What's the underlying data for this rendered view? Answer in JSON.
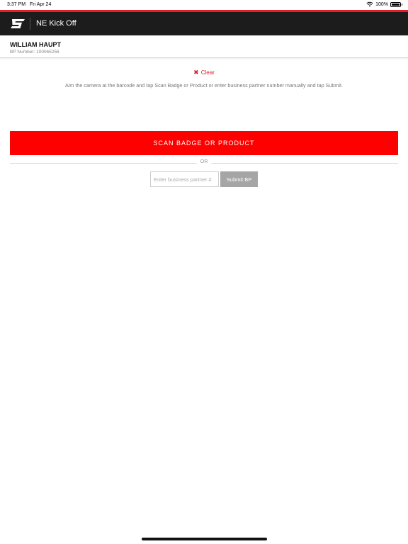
{
  "status_bar": {
    "time": "3:37 PM",
    "date": "Fri Apr 24",
    "battery": "100%",
    "wifi_icon": "wifi-icon",
    "battery_icon": "battery-icon"
  },
  "header": {
    "logo_icon": "snap-on-logo-icon",
    "title": "NE Kick Off",
    "accent_color": "#e41e26",
    "background_color": "#1c1c1c"
  },
  "user": {
    "name": "WILLIAM HAUPT",
    "bp_number": "BP Number: 100065256"
  },
  "main": {
    "clear_icon": "close-icon",
    "clear_label": "Clear",
    "instructions": "Aim the camera at the barcode and tap Scan Badge or Product or enter business partner number manually and tap Submit.",
    "scan_button_label": "SCAN BADGE OR PRODUCT",
    "scan_button_color": "#ff0000",
    "or_label": "OR",
    "bp_input_placeholder": "Enter business partner #",
    "bp_input_value": "",
    "submit_label": "Submit BP",
    "submit_color": "#a5a5a5"
  }
}
